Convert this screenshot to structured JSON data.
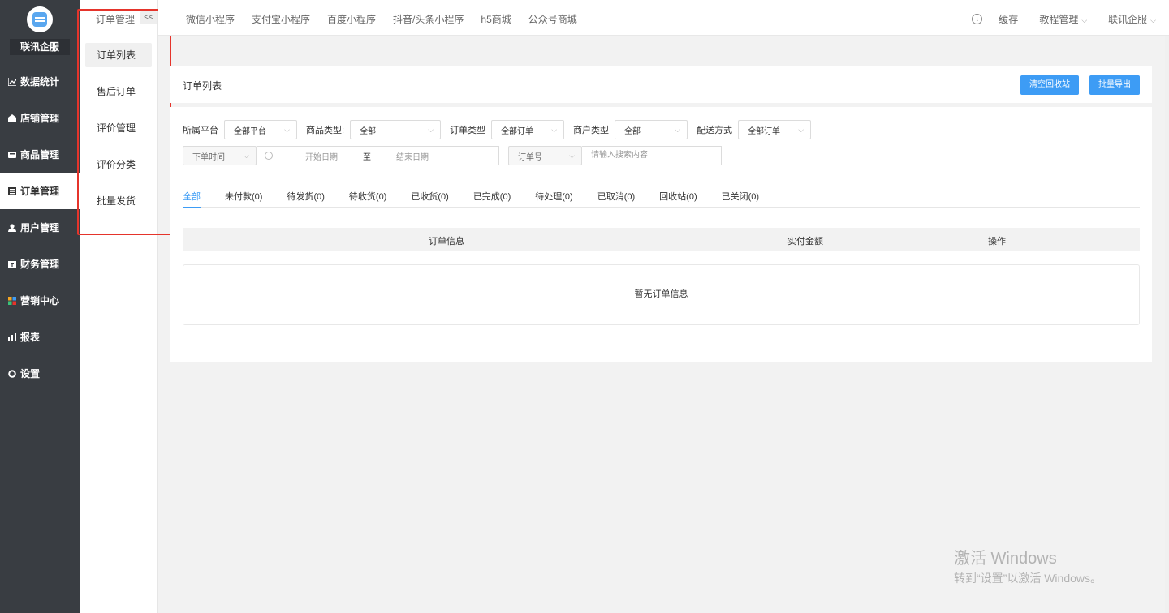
{
  "sidebar": {
    "brand": "联讯企服",
    "items": [
      {
        "label": "数据统计",
        "icon": "line-chart-icon"
      },
      {
        "label": "店铺管理",
        "icon": "store-icon"
      },
      {
        "label": "商品管理",
        "icon": "goods-icon"
      },
      {
        "label": "订单管理",
        "icon": "order-icon",
        "active": true
      },
      {
        "label": "用户管理",
        "icon": "user-icon"
      },
      {
        "label": "财务管理",
        "icon": "finance-icon"
      },
      {
        "label": "营销中心",
        "icon": "marketing-icon"
      },
      {
        "label": "报表",
        "icon": "bar-chart-icon"
      },
      {
        "label": "设置",
        "icon": "gear-icon"
      }
    ]
  },
  "subnav": {
    "title": "订单管理",
    "collapse": "<<",
    "items": [
      "订单列表",
      "售后订单",
      "评价管理",
      "评价分类",
      "批量发货"
    ]
  },
  "topbar": {
    "nav": [
      "微信小程序",
      "支付宝小程序",
      "百度小程序",
      "抖音/头条小程序",
      "h5商城",
      "公众号商城"
    ],
    "cache": "缓存",
    "tutorial": "教程管理",
    "account": "联讯企服"
  },
  "page": {
    "title": "订单列表",
    "btn_clear": "清空回收站",
    "btn_export": "批量导出"
  },
  "filters": {
    "platform_label": "所属平台",
    "platform_value": "全部平台",
    "goods_type_label": "商品类型:",
    "goods_type_value": "全部",
    "order_type_label": "订单类型",
    "order_type_value": "全部订单",
    "merchant_type_label": "商户类型",
    "merchant_type_value": "全部",
    "delivery_label": "配送方式",
    "delivery_value": "全部订单",
    "time_select": "下单时间",
    "start_date": "开始日期",
    "range_sep": "至",
    "end_date": "结束日期",
    "search_field": "订单号",
    "search_placeholder": "请输入搜索内容"
  },
  "tabs": [
    "全部",
    "未付款(0)",
    "待发货(0)",
    "待收货(0)",
    "已收货(0)",
    "已完成(0)",
    "待处理(0)",
    "已取消(0)",
    "回收站(0)",
    "已关闭(0)"
  ],
  "table": {
    "headers": [
      "订单信息",
      "实付金额",
      "操作"
    ],
    "empty": "暂无订单信息"
  },
  "watermark": {
    "line1": "激活 Windows",
    "line2": "转到“设置”以激活 Windows。"
  }
}
